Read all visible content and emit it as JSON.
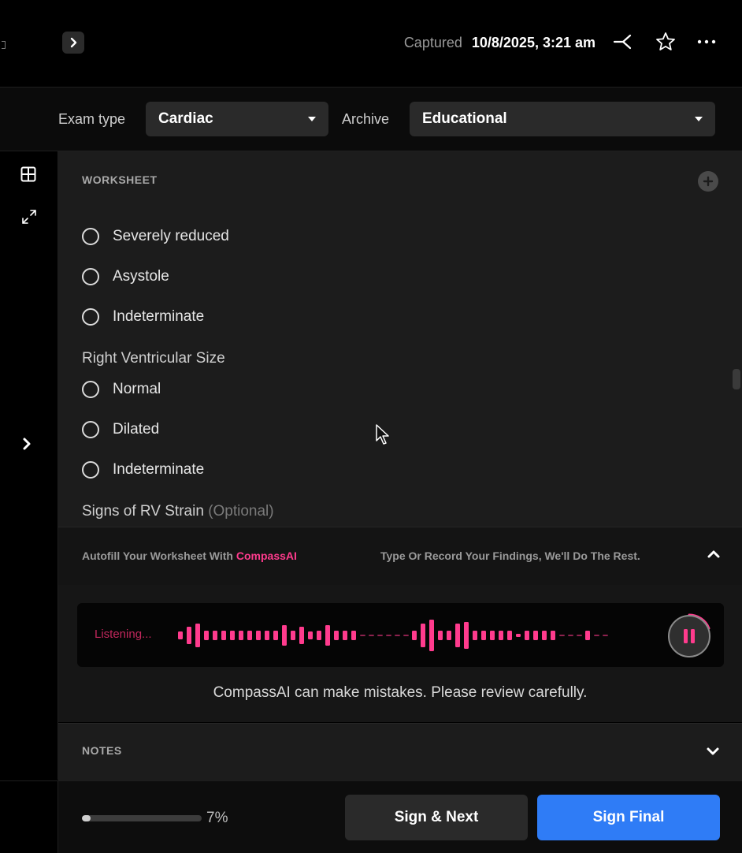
{
  "header": {
    "captured_label": "Captured",
    "captured_date": "10/8/2025, 3:21 am",
    "icons": [
      "expand-chevron-icon",
      "share-icon",
      "star-icon",
      "more-icon"
    ]
  },
  "filters": {
    "exam_type_label": "Exam type",
    "exam_type_value": "Cardiac",
    "archive_label": "Archive",
    "archive_value": "Educational"
  },
  "rail": {
    "icons": [
      "grid-icon",
      "fullscreen-icon",
      "chevron-right-icon"
    ]
  },
  "worksheet": {
    "title": "WORKSHEET",
    "options_group1": [
      {
        "label": "Severely reduced"
      },
      {
        "label": "Asystole"
      },
      {
        "label": "Indeterminate"
      }
    ],
    "rv_size_label": "Right Ventricular Size",
    "options_group2": [
      {
        "label": "Normal"
      },
      {
        "label": "Dilated"
      },
      {
        "label": "Indeterminate"
      }
    ],
    "rv_strain_label": "Signs of RV Strain",
    "rv_strain_optional": "(Optional)"
  },
  "autofill": {
    "prefix": "Autofill Your Worksheet With",
    "brand": "CompassAI",
    "hint": "Type Or Record Your Findings, We'll Do The Rest."
  },
  "listening": {
    "status": "Listening...",
    "disclaimer": "CompassAI can make mistakes. Please review carefully."
  },
  "notes": {
    "title": "NOTES"
  },
  "footer": {
    "progress_fraction": 0.07,
    "progress_text": "7%",
    "sign_next_label": "Sign & Next",
    "sign_final_label": "Sign Final"
  },
  "colors": {
    "accent_pink": "#ff3b8d",
    "primary_blue": "#2f7cf6",
    "background": "#000000",
    "panel": "#1c1c1c"
  }
}
